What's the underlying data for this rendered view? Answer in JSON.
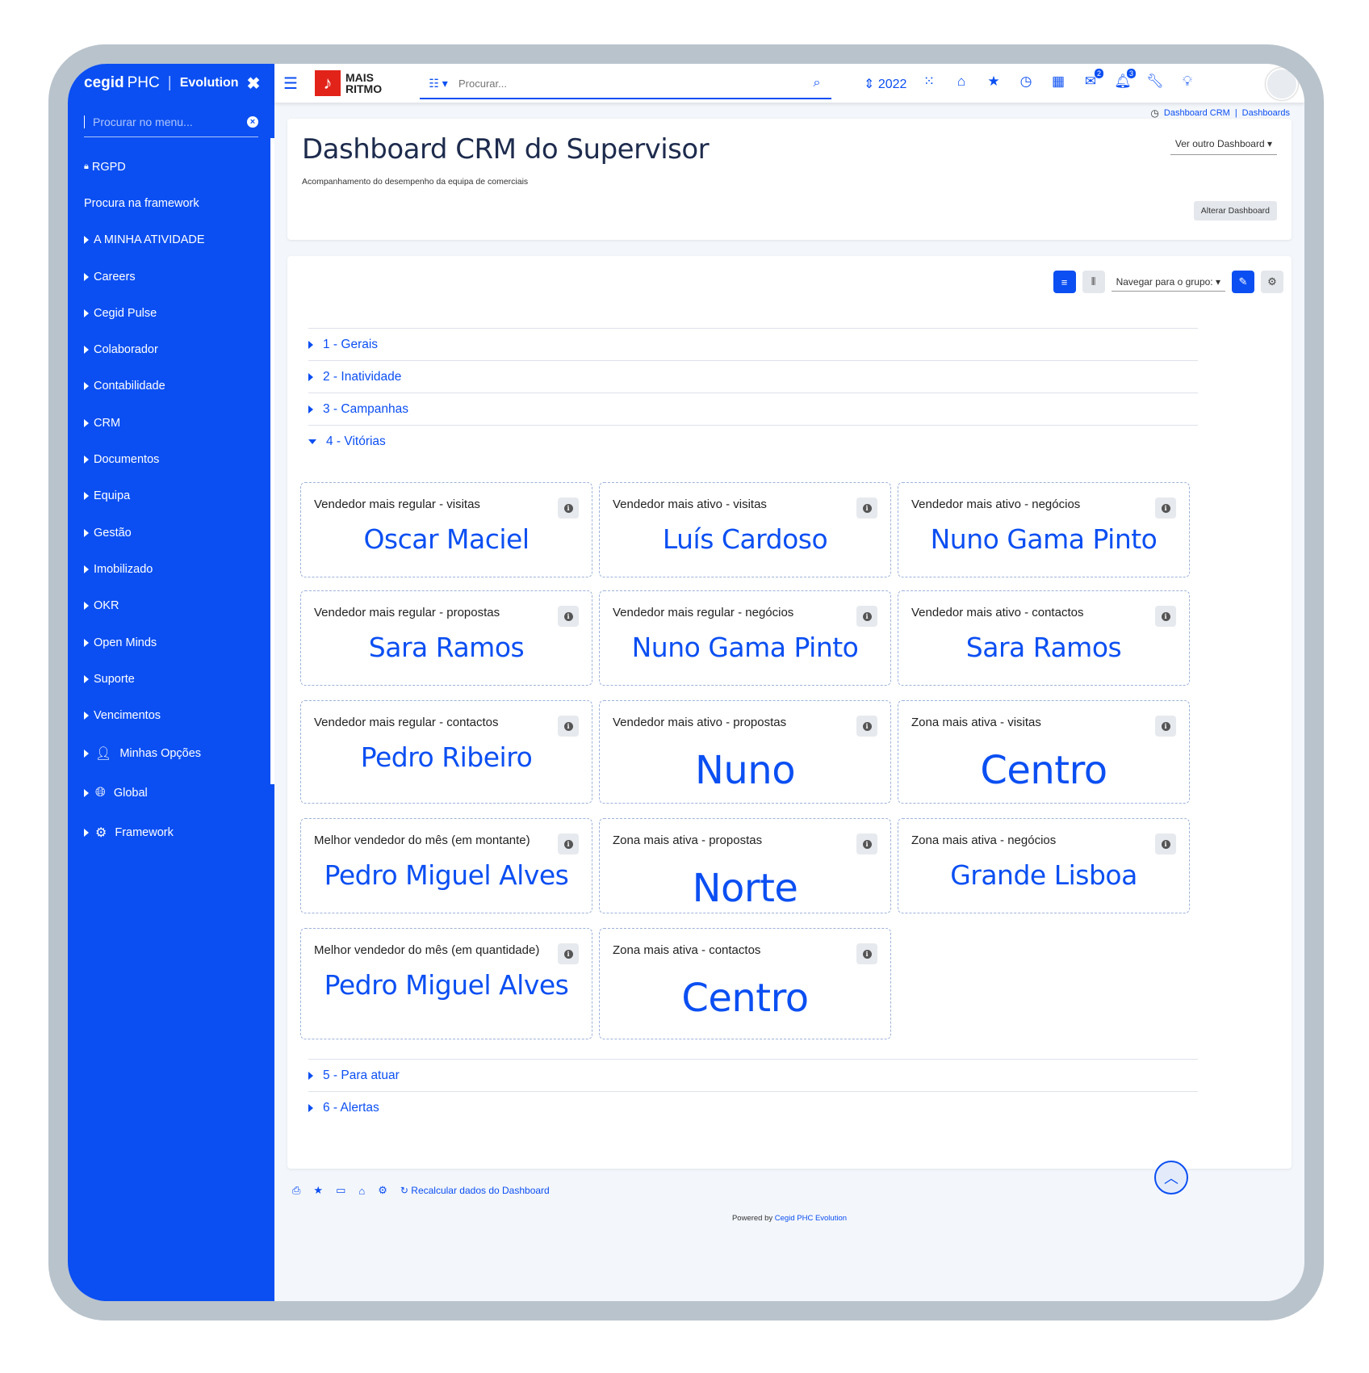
{
  "brand": {
    "cegid": "cegid",
    "phc": "PHC",
    "evolution": "Evolution",
    "close": "✖"
  },
  "sidebar": {
    "search_placeholder": "Procurar no menu...",
    "items": [
      {
        "label": "RGPD",
        "icon": "lock-icon"
      },
      {
        "label": "Procura na framework"
      },
      {
        "label": "A MINHA ATIVIDADE"
      },
      {
        "label": "Careers"
      },
      {
        "label": "Cegid Pulse"
      },
      {
        "label": "Colaborador"
      },
      {
        "label": "Contabilidade"
      },
      {
        "label": "CRM"
      },
      {
        "label": "Documentos"
      },
      {
        "label": "Equipa"
      },
      {
        "label": "Gestão"
      },
      {
        "label": "Imobilizado"
      },
      {
        "label": "OKR"
      },
      {
        "label": "Open Minds"
      },
      {
        "label": "Suporte"
      },
      {
        "label": "Vencimentos"
      },
      {
        "label": "Minhas Opções",
        "icon": "user-icon"
      },
      {
        "label": "Global",
        "icon": "globe-icon"
      },
      {
        "label": "Framework",
        "icon": "cogs-icon"
      }
    ]
  },
  "topbar": {
    "logo_line1": "MAIS",
    "logo_line2": "RITMO",
    "search_placeholder": "Procurar...",
    "year": "2022",
    "badges": {
      "messages": "2",
      "notifications": "3"
    }
  },
  "breadcrumb": {
    "item1": "Dashboard CRM",
    "sep": "|",
    "item2": "Dashboards"
  },
  "header": {
    "title": "Dashboard CRM do Supervisor",
    "subtitle": "Acompanhamento do desempenho da equipa de comerciais",
    "other_dashboard": "Ver outro Dashboard ▾",
    "change_button": "Alterar Dashboard"
  },
  "toolbar": {
    "navigate_label": "Navegar para o grupo: ▾"
  },
  "groups": {
    "g1": "1 - Gerais",
    "g2": "2 - Inatividade",
    "g3": "3 - Campanhas",
    "g4": "4 - Vitórias",
    "g5": "5 - Para atuar",
    "g6": "6 - Alertas"
  },
  "cards": [
    {
      "label": "Vendedor mais regular - visitas",
      "value": "Oscar Maciel"
    },
    {
      "label": "Vendedor mais ativo - visitas",
      "value": "Luís Cardoso"
    },
    {
      "label": "Vendedor mais ativo - negócios",
      "value": "Nuno Gama Pinto"
    },
    {
      "label": "Vendedor mais regular - propostas",
      "value": "Sara Ramos"
    },
    {
      "label": "Vendedor mais regular - negócios",
      "value": "Nuno Gama Pinto"
    },
    {
      "label": "Vendedor mais ativo - contactos",
      "value": "Sara Ramos"
    },
    {
      "label": "Vendedor mais regular - contactos",
      "value": "Pedro Ribeiro"
    },
    {
      "label": "Vendedor mais ativo - propostas",
      "value": "Nuno"
    },
    {
      "label": "Zona mais ativa - visitas",
      "value": "Centro"
    },
    {
      "label": "Melhor vendedor do mês (em montante)",
      "value": "Pedro Miguel Alves"
    },
    {
      "label": "Zona mais ativa - propostas",
      "value": "Norte"
    },
    {
      "label": "Zona mais ativa - negócios",
      "value": "Grande Lisboa"
    },
    {
      "label": "Melhor vendedor do mês (em quantidade)",
      "value": "Pedro Miguel Alves"
    },
    {
      "label": "Zona mais ativa - contactos",
      "value": "Centro"
    }
  ],
  "footer": {
    "recalc": "Recalcular dados do Dashboard",
    "powered_prefix": "Powered by",
    "powered_brand": "Cegid PHC Evolution"
  },
  "colors": {
    "accent": "#0b4ff2",
    "sidebar": "#0b4ff2",
    "logo_red": "#e2231a"
  }
}
